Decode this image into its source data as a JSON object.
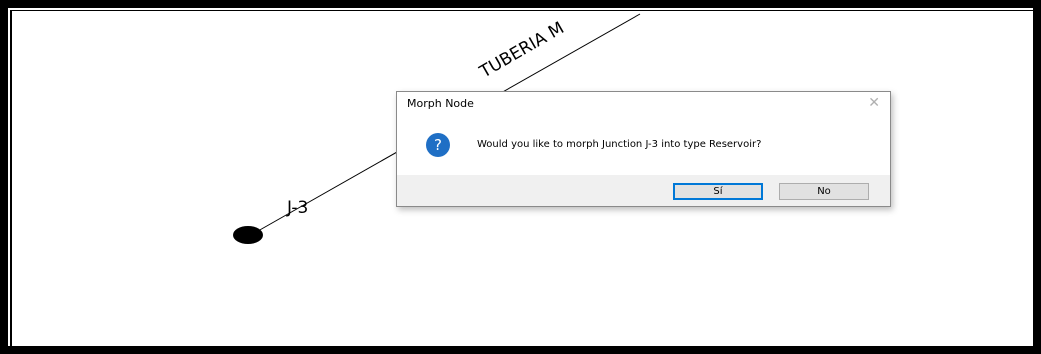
{
  "canvas": {
    "pipe_label": "TUBERIA M",
    "node_label": "J-3"
  },
  "dialog": {
    "title": "Morph Node",
    "close_glyph": "✕",
    "icon": "question-icon",
    "icon_glyph": "?",
    "message": "Would you like to morph Junction J-3 into type Reservoir?",
    "yes_label": "Sí",
    "no_label": "No"
  },
  "colors": {
    "frame": "#000000",
    "dialog_footer": "#f0f0f0",
    "question_icon": "#1f6fc5",
    "default_button_border": "#0078d7"
  }
}
